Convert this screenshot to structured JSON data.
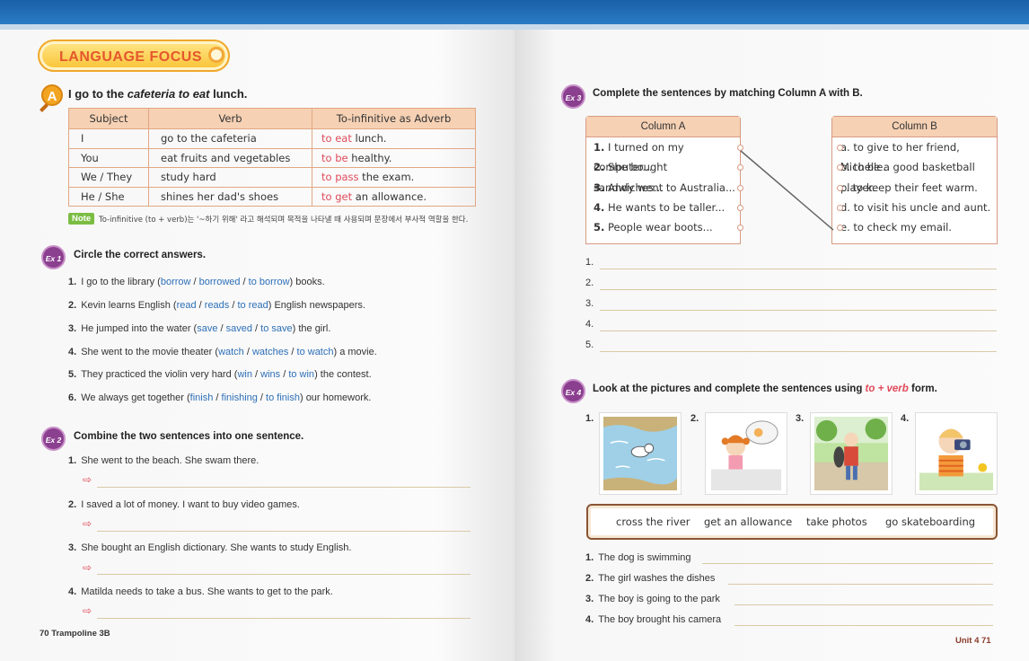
{
  "left_page": {
    "section_title": "LANGUAGE FOCUS",
    "section_a": {
      "icon_letter": "A",
      "title_pre": "I go to the ",
      "title_italic": "cafeteria to eat",
      "title_post": " lunch."
    },
    "grammar_table": {
      "headers": [
        "Subject",
        "Verb",
        "To-infinitive as Adverb"
      ],
      "rows": [
        {
          "subject": "I",
          "verb": "go to the cafeteria",
          "inf": "to eat",
          "rest": " lunch."
        },
        {
          "subject": "You",
          "verb": "eat fruits and vegetables",
          "inf": "to be",
          "rest": " healthy."
        },
        {
          "subject": "We / They",
          "verb": "study hard",
          "inf": "to pass",
          "rest": " the exam."
        },
        {
          "subject": "He / She",
          "verb": "shines her dad's shoes",
          "inf": "to get",
          "rest": " an allowance."
        }
      ]
    },
    "note": {
      "tag": "Note",
      "text": "To-infinitive (to + verb)는 '~하기 위해' 라고 해석되며 목적을 나타낼 때 사용되며 문장에서 부사적 역할을 한다."
    },
    "ex1": {
      "badge": "Ex 1",
      "title": "Circle the correct answers.",
      "items": [
        {
          "num": "1.",
          "pre": "I go to the library (",
          "opts": [
            "borrow",
            "borrowed",
            "to borrow"
          ],
          "post": ") books."
        },
        {
          "num": "2.",
          "pre": "Kevin learns English (",
          "opts": [
            "read",
            "reads",
            "to read"
          ],
          "post": ") English newspapers."
        },
        {
          "num": "3.",
          "pre": "He jumped into the water (",
          "opts": [
            "save",
            "saved",
            "to save"
          ],
          "post": ") the girl."
        },
        {
          "num": "4.",
          "pre": "She went to the movie theater (",
          "opts": [
            "watch",
            "watches",
            "to watch"
          ],
          "post": ") a movie."
        },
        {
          "num": "5.",
          "pre": "They practiced the violin very hard (",
          "opts": [
            "win",
            "wins",
            "to win"
          ],
          "post": ") the contest."
        },
        {
          "num": "6.",
          "pre": "We always get together (",
          "opts": [
            "finish",
            "finishing",
            "to finish"
          ],
          "post": ") our homework."
        }
      ]
    },
    "ex2": {
      "badge": "Ex 2",
      "title": "Combine the two sentences into one sentence.",
      "arrow": "⇨",
      "items": [
        {
          "num": "1.",
          "text": "She went to the beach. She swam there."
        },
        {
          "num": "2.",
          "text": "I saved a lot of money. I want to buy video games."
        },
        {
          "num": "3.",
          "text": "She bought an English dictionary. She wants to study English."
        },
        {
          "num": "4.",
          "text": "Matilda needs to take a bus. She wants to get to the park."
        }
      ]
    },
    "footer": "70  Trampoline 3B"
  },
  "right_page": {
    "ex3": {
      "badge": "Ex 3",
      "title": "Complete the sentences by matching Column A with B.",
      "column_a": {
        "header": "Column A",
        "items": [
          {
            "num": "1.",
            "text": "I turned on my computer..."
          },
          {
            "num": "2.",
            "text": "She bought sandwiches..."
          },
          {
            "num": "3.",
            "text": "Andy went to Australia..."
          },
          {
            "num": "4.",
            "text": "He wants to be taller..."
          },
          {
            "num": "5.",
            "text": "People wear boots..."
          }
        ]
      },
      "column_b": {
        "header": "Column B",
        "items": [
          "a. to give to her friend, Michelle.",
          "b. to be a good basketball player.",
          "c. to keep their feet warm.",
          "d. to visit his uncle and aunt.",
          "e. to check my email."
        ]
      },
      "answer_nums": [
        "1.",
        "2.",
        "3.",
        "4.",
        "5."
      ]
    },
    "ex4": {
      "badge": "Ex 4",
      "title_pre": "Look at the pictures and complete the sentences using ",
      "title_highlight": "to + verb",
      "title_post": " form.",
      "picture_nums": [
        "1.",
        "2.",
        "3.",
        "4."
      ],
      "word_bank": [
        "cross the river",
        "get an allowance",
        "take photos",
        "go skateboarding"
      ],
      "sentences": [
        {
          "num": "1.",
          "text": "The dog is swimming"
        },
        {
          "num": "2.",
          "text": "The girl washes the dishes"
        },
        {
          "num": "3.",
          "text": "The boy is going to the park"
        },
        {
          "num": "4.",
          "text": "The boy brought his camera"
        }
      ]
    },
    "footer": "Unit 4  71"
  },
  "colors": {
    "header_blue": "#1a61a8",
    "table_header": "#f6d1b4",
    "accent_red": "#e04a5a",
    "option_blue": "#2d6fb7",
    "ex_badge": "#8b3f8f"
  }
}
